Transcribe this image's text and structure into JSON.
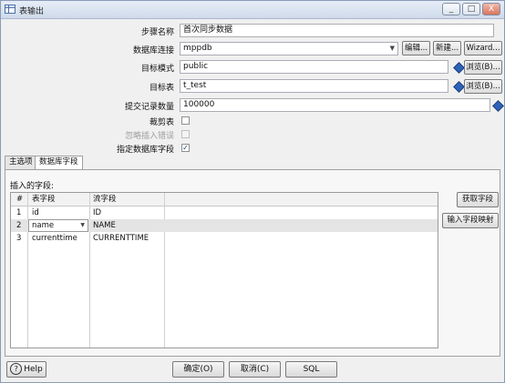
{
  "window": {
    "title": "表输出",
    "controls": [
      "_",
      "□",
      "X"
    ]
  },
  "form": {
    "step_name": {
      "label": "步骤名称",
      "value": "首次同步数据"
    },
    "connection": {
      "label": "数据库连接",
      "value": "mppdb",
      "edit": "编辑...",
      "new": "新建...",
      "wizard": "Wizard..."
    },
    "schema": {
      "label": "目标模式",
      "value": "public",
      "browse": "浏览(B)..."
    },
    "table": {
      "label": "目标表",
      "value": "t_test",
      "browse": "浏览(B)..."
    },
    "commit_size": {
      "label": "提交记录数量",
      "value": "100000"
    },
    "truncate": {
      "label": "裁剪表",
      "checked": false
    },
    "ignore_errors": {
      "label": "忽略插入错误",
      "checked": false
    },
    "specify_fields": {
      "label": "指定数据库字段",
      "checked": true,
      "mark": "✓"
    }
  },
  "tabs": [
    {
      "label": "主选项"
    },
    {
      "label": "数据库字段"
    }
  ],
  "fields_panel": {
    "insert_label": "插入的字段:",
    "columns": [
      "#",
      "表字段",
      "流字段"
    ],
    "rows": [
      {
        "num": "1",
        "table_field": "id",
        "stream_field": "ID"
      },
      {
        "num": "2",
        "table_field": "name",
        "stream_field": "NAME"
      },
      {
        "num": "3",
        "table_field": "currenttime",
        "stream_field": "CURRENTTIME"
      }
    ],
    "get_fields": "获取字段",
    "enter_mapping": "输入字段映射"
  },
  "footer": {
    "help": "Help",
    "ok": "确定(O)",
    "cancel": "取消(C)",
    "sql": "SQL"
  }
}
